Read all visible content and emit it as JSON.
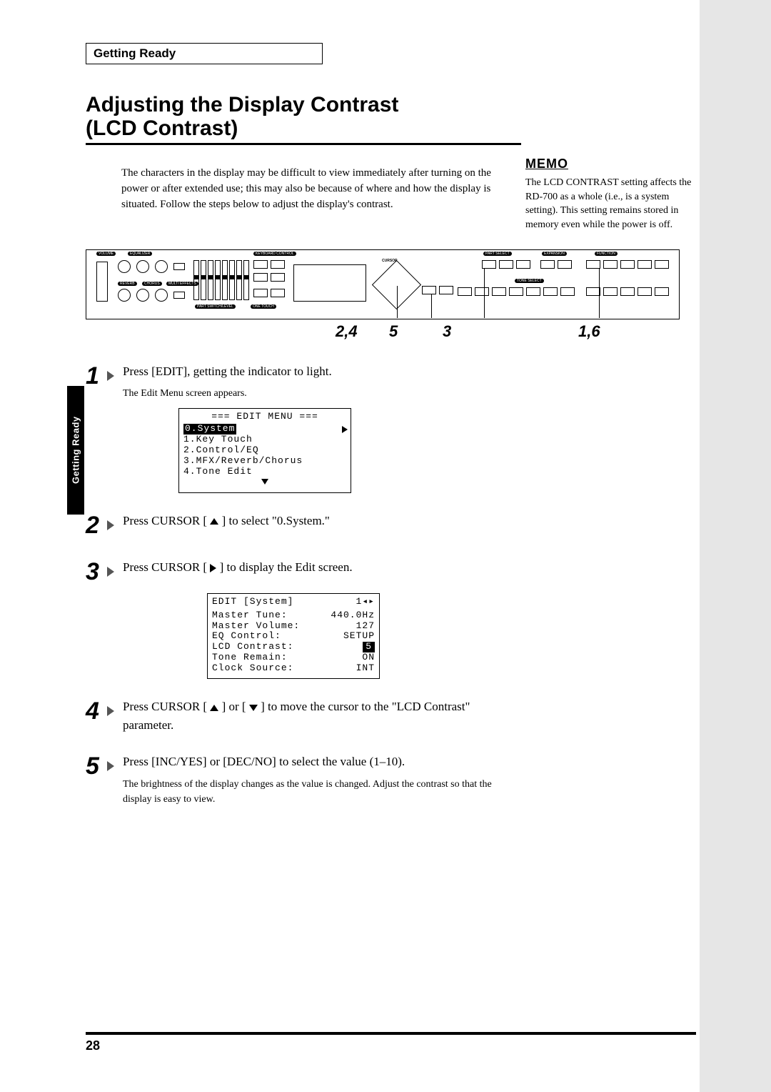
{
  "section_header": "Getting Ready",
  "sidebar_tab": "Getting Ready",
  "title_line1": "Adjusting the Display Contrast",
  "title_line2": " (LCD Contrast)",
  "intro": "The characters in the display may be difficult to view immediately after turning on the power or after extended use; this may also be because of where and how the display is situated. Follow the steps below to adjust the display's contrast.",
  "memo": {
    "label": "MEMO",
    "text": "The LCD CONTRAST setting affects the RD-700 as a whole (i.e., is a system setting). This setting remains stored in memory even while the power is off."
  },
  "panel": {
    "labels": {
      "volume": "VOLUME",
      "equalizer": "EQUALIZER",
      "reverb": "REVERB",
      "chorus": "CHORUS",
      "multi_effects": "MULTI EFFECTS",
      "keyboard_control": "KEYBOARD CONTROL",
      "part_select": "PART SELECT",
      "expansion": "EXPANSION",
      "function": "FUNCTION",
      "tone_select": "TONE SELECT",
      "part_switch": "PART SWITCH/LEVEL",
      "one_touch": "ONE TOUCH",
      "cursor": "CURSOR"
    }
  },
  "callouts": {
    "c1": "2,4",
    "c2": "5",
    "c3": "3",
    "c4": "1,6"
  },
  "steps": {
    "s1": {
      "num": "1",
      "text": "Press [EDIT], getting the indicator to light.",
      "sub": "The Edit Menu screen appears."
    },
    "s2": {
      "num": "2",
      "text_a": "Press CURSOR [",
      "text_b": "] to select \"0.System.\""
    },
    "s3": {
      "num": "3",
      "text_a": "Press CURSOR [",
      "text_b": "] to display the Edit screen."
    },
    "s4": {
      "num": "4",
      "text_a": "Press CURSOR [",
      "text_b": "] or [",
      "text_c": "] to move the cursor to the \"LCD Contrast\" parameter."
    },
    "s5": {
      "num": "5",
      "text": "Press [INC/YES] or [DEC/NO] to select the value (1–10).",
      "sub": "The brightness of the display changes as the value is changed. Adjust the contrast so that the display is easy to view."
    }
  },
  "lcd1": {
    "title": "=== EDIT MENU ===",
    "items": [
      "0.System",
      "1.Key Touch",
      "2.Control/EQ",
      "3.MFX/Reverb/Chorus",
      "4.Tone Edit"
    ]
  },
  "lcd2": {
    "title_left": "EDIT [System]",
    "title_right": "1",
    "rows": [
      {
        "l": "Master Tune:",
        "r": "440.0Hz"
      },
      {
        "l": "Master Volume:",
        "r": "127"
      },
      {
        "l": "EQ Control:",
        "r": "SETUP"
      },
      {
        "l": "LCD Contrast:",
        "r": "5"
      },
      {
        "l": "Tone Remain:",
        "r": "ON"
      },
      {
        "l": "Clock Source:",
        "r": "INT"
      }
    ]
  },
  "page_number": "28"
}
